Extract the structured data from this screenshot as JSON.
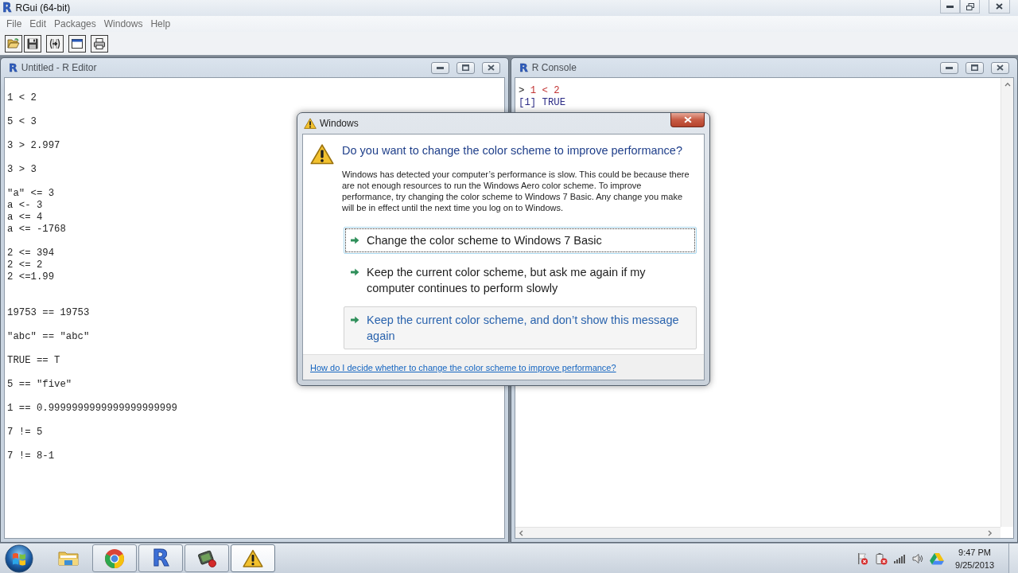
{
  "app_window": {
    "logo": "R",
    "title": "RGui (64-bit)"
  },
  "menu_bar": {
    "items": [
      "File",
      "Edit",
      "Packages",
      "Windows",
      "Help"
    ]
  },
  "editor": {
    "logo": "R",
    "title": "Untitled - R Editor",
    "text": "1 < 2\n\n5 < 3\n\n3 > 2.997\n\n3 > 3\n\n\"a\" <= 3\na <- 3\na <= 4\na <= -1768\n\n2 <= 394\n2 <= 2\n2 <=1.99\n\n\n19753 == 19753\n\n\"abc\" == \"abc\"\n\nTRUE == T\n\n5 == \"five\"\n\n1 == 0.9999999999999999999999\n\n7 != 5\n\n7 != 8-1"
  },
  "console": {
    "logo": "R",
    "title": "R Console",
    "lines": [
      {
        "kind": "input",
        "prompt": ">",
        "text": "1 < 2"
      },
      {
        "kind": "output",
        "text": "[1] TRUE"
      }
    ]
  },
  "dialog": {
    "title": "Windows",
    "heading": "Do you want to change the color scheme to improve performance?",
    "message": "Windows has detected your computer’s performance is slow. This could be because there\nare not enough resources to run the Windows Aero color scheme. To improve\nperformance, try changing the color scheme to Windows 7 Basic. Any change you make\nwill be in effect until the next time you log on to Windows.",
    "options": [
      {
        "label": "Change the color scheme to Windows 7 Basic",
        "focused": true,
        "hovered": false
      },
      {
        "label": "Keep the current color scheme, but ask me again if my computer continues to perform slowly",
        "focused": false,
        "hovered": false
      },
      {
        "label": "Keep the current color scheme, and don’t show this message again",
        "focused": false,
        "hovered": true
      }
    ],
    "help_link": "How do I decide whether to change the color scheme to improve performance?"
  },
  "taskbar": {
    "buttons": [
      {
        "kind": "folder",
        "running": false,
        "active": false
      },
      {
        "kind": "browser",
        "running": true,
        "active": false
      },
      {
        "kind": "r",
        "label": "R",
        "running": true,
        "active": false
      },
      {
        "kind": "app",
        "running": true,
        "active": false
      },
      {
        "kind": "warning",
        "running": true,
        "active": true
      }
    ],
    "clock": {
      "time": "9:47 PM",
      "date": "9/25/2013"
    }
  }
}
